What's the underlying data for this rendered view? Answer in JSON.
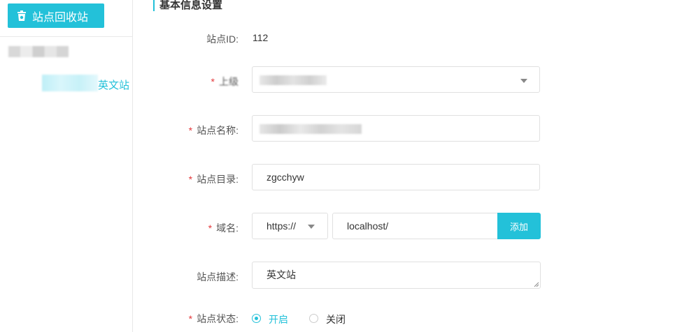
{
  "sidebar": {
    "recycle_button_label": "站点回收站",
    "tree_item_2_suffix": "英文站"
  },
  "form": {
    "section_title": "基本信息设置",
    "site_id": {
      "label": "站点ID:",
      "value": "112"
    },
    "parent": {
      "label": "上级"
    },
    "site_name": {
      "label": "站点名称:"
    },
    "site_dir": {
      "label": "站点目录:",
      "value": "zgcchyw"
    },
    "domain": {
      "label": "域名:",
      "protocol": "https://",
      "value": "localhost/",
      "add_label": "添加"
    },
    "description": {
      "label": "站点描述:",
      "value": "英文站"
    },
    "status": {
      "label": "站点状态:",
      "option_on": "开启",
      "option_off": "关闭",
      "selected": "开启"
    },
    "required_mark": "*"
  },
  "colors": {
    "accent": "#23c1d9",
    "required": "#e4393c"
  }
}
